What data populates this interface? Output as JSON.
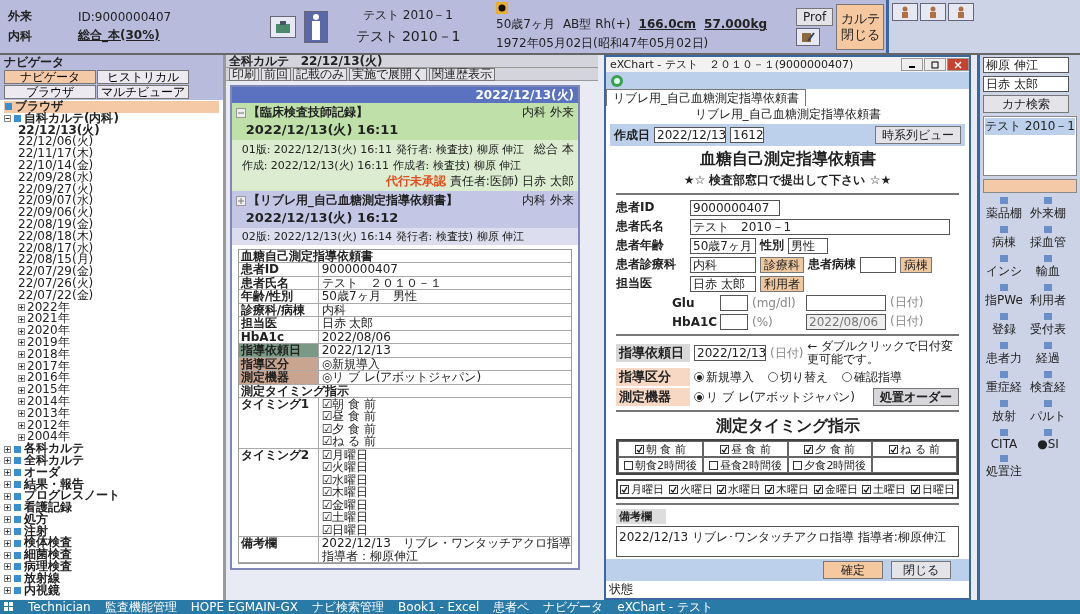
{
  "header": {
    "visit_type": "外来",
    "department": "内科",
    "patient_id": "ID:9000000407",
    "insurance": "総合_本(30%)",
    "patient_name_small": "テスト 2010－1",
    "patient_name": "テスト 2010－1",
    "age": "50歳7ヶ月",
    "blood_type": "AB型 Rh(+)",
    "height": "166.0cm",
    "weight": "57.000kg",
    "birthdate": "1972年05月02日(昭和47年05月02日)",
    "prof_button": "Prof",
    "close_button": "カルテ閉じる"
  },
  "navigator": {
    "title": "ナビゲータ",
    "tabs": [
      {
        "label": "ナビゲータ",
        "selected": true
      },
      {
        "label": "ヒストリカル",
        "selected": false
      },
      {
        "label": "ブラウザ",
        "selected": false
      },
      {
        "label": "マルチビューア",
        "selected": false
      }
    ],
    "tree": [
      {
        "label": "ブラウザ",
        "selected": true
      },
      {
        "label": "自科カルテ(内科)",
        "selected": false,
        "expanded": true,
        "children": [
          {
            "label": "22/12/13(火)",
            "selected": true
          },
          {
            "label": "22/12/06(火)",
            "selected": false
          },
          {
            "label": "22/11/17(木)",
            "selected": false
          },
          {
            "label": "22/10/14(金)",
            "selected": false
          },
          {
            "label": "22/09/28(水)",
            "selected": false
          },
          {
            "label": "22/09/27(火)",
            "selected": false
          },
          {
            "label": "22/09/07(水)",
            "selected": false
          },
          {
            "label": "22/09/06(火)",
            "selected": false
          },
          {
            "label": "22/08/19(金)",
            "selected": false
          },
          {
            "label": "22/08/18(木)",
            "selected": false
          },
          {
            "label": "22/08/17(水)",
            "selected": false
          },
          {
            "label": "22/08/15(月)",
            "selected": false
          },
          {
            "label": "22/07/29(金)",
            "selected": false
          },
          {
            "label": "22/07/26(火)",
            "selected": false
          },
          {
            "label": "22/07/22(金)",
            "selected": false
          },
          {
            "label": "2022年",
            "selected": false,
            "expanded": false
          },
          {
            "label": "2021年",
            "selected": false,
            "expanded": false
          },
          {
            "label": "2020年",
            "selected": false,
            "expanded": false
          },
          {
            "label": "2019年",
            "selected": false,
            "expanded": false
          },
          {
            "label": "2018年",
            "selected": false,
            "expanded": false
          },
          {
            "label": "2017年",
            "selected": false,
            "expanded": false
          },
          {
            "label": "2016年",
            "selected": false,
            "expanded": false
          },
          {
            "label": "2015年",
            "selected": false,
            "expanded": false
          },
          {
            "label": "2014年",
            "selected": false,
            "expanded": false
          },
          {
            "label": "2013年",
            "selected": false,
            "expanded": false
          },
          {
            "label": "2012年",
            "selected": false,
            "expanded": false
          },
          {
            "label": "2004年",
            "selected": false,
            "expanded": false
          }
        ]
      },
      {
        "label": "各科カルテ",
        "selected": false,
        "expanded": false
      },
      {
        "label": "全科カルテ",
        "selected": false,
        "expanded": false
      },
      {
        "label": "オーダ",
        "selected": false,
        "expanded": false
      },
      {
        "label": "結果・報告",
        "selected": false,
        "expanded": false
      },
      {
        "label": "プログレスノート",
        "selected": false,
        "expanded": false
      },
      {
        "label": "看護記録",
        "selected": false,
        "expanded": false
      },
      {
        "label": "処方",
        "selected": false,
        "expanded": false
      },
      {
        "label": "注射",
        "selected": false,
        "expanded": false
      },
      {
        "label": "検体検査",
        "selected": false,
        "expanded": false
      },
      {
        "label": "細菌検査",
        "selected": false,
        "expanded": false
      },
      {
        "label": "病理検査",
        "selected": false,
        "expanded": false
      },
      {
        "label": "放射線",
        "selected": false,
        "expanded": false
      },
      {
        "label": "内視鏡",
        "selected": false,
        "expanded": false
      }
    ]
  },
  "chart_view": {
    "title": "全科カルテ　22/12/13(火)",
    "toolbar": [
      "印刷",
      "前回",
      "記載のみ",
      "実施で展開く",
      "関連歴表示"
    ],
    "date": "2022/12/13(火)",
    "records": [
      {
        "kind": "technician",
        "expanded": true,
        "title": "【臨床検査技師記録】",
        "department": "内科 外来",
        "datetime": "2022/12/13(火) 16:11",
        "lines": [
          "01版: 2022/12/13(火) 16:11 発行者: 検査技) 柳原 伸江",
          "作成: 2022/12/13(火) 16:11 作成者: 検査技) 柳原 伸江"
        ],
        "insurance": "総合 本",
        "approval": "代行未承認",
        "responsible": "責任者:医師) 日赤 太郎"
      },
      {
        "kind": "document",
        "expanded": false,
        "title": "【リブレ用_自己血糖測定指導依頼書】",
        "department": "内科 外来",
        "datetime": "2022/12/13(火) 16:12",
        "lines": [
          "02版: 2022/12/13(火) 16:14 発行者: 検査技) 柳原 伸江"
        ]
      }
    ],
    "summary": [
      {
        "kind": "title",
        "label": "血糖自己測定指導依頼書"
      },
      {
        "kind": "row",
        "label": "患者ID",
        "values": [
          "9000000407"
        ]
      },
      {
        "kind": "row",
        "label": "患者氏名",
        "values": [
          "テスト　２０１０－１"
        ]
      },
      {
        "kind": "row",
        "label": "年齢/性別",
        "values": [
          "50歳7ヶ月　男性"
        ]
      },
      {
        "kind": "row",
        "label": "診療科/病棟",
        "values": [
          "内科"
        ]
      },
      {
        "kind": "row",
        "label": "担当医",
        "values": [
          "日赤 太郎"
        ]
      },
      {
        "kind": "row",
        "label": "HbA1c",
        "values": [
          "2022/08/06"
        ]
      },
      {
        "kind": "row",
        "label": "指導依頼日",
        "values": [
          "2022/12/13"
        ],
        "color": "#7a9a86"
      },
      {
        "kind": "row",
        "label": "指導区分",
        "values": [
          "◎新規導入"
        ],
        "color": "#c9a48e"
      },
      {
        "kind": "row",
        "label": "測定機器",
        "values": [
          "◎リ ブ レ(アボットジャパン)"
        ],
        "color": "#c9a48e"
      },
      {
        "kind": "title",
        "label": "測定タイミング指示"
      },
      {
        "kind": "row",
        "label": "タイミング1",
        "values": [
          "☑朝 食 前",
          "☑昼 食 前",
          "☑夕 食 前",
          "☑ね る 前"
        ]
      },
      {
        "kind": "row",
        "label": "タイミング2",
        "values": [
          "☑月曜日",
          "☑火曜日",
          "☑水曜日",
          "☑木曜日",
          "☑金曜日",
          "☑土曜日",
          "☑日曜日"
        ]
      },
      {
        "kind": "row",
        "label": "備考欄",
        "values": [
          "2022/12/13　リブレ・ワンタッチアクロ指導",
          "指導者：柳原伸江"
        ]
      }
    ]
  },
  "form_window": {
    "title": "eXChart - テスト　２０１０－１(9000000407)",
    "tab": "リブレ用_自己血糖測定指導依頼書",
    "subtitle": "リブレ用_自己血糖測定指導依頼書",
    "created_label": "作成日",
    "created_date": "2022/12/13",
    "created_time": "1612",
    "timeline_button": "時系列ビュー",
    "heading": "血糖自己測定指導依頼書",
    "note": "★☆ 検査部窓口で提出して下さい ☆★",
    "fields": [
      {
        "label": "患者ID",
        "value": "9000000407",
        "kind": "short"
      },
      {
        "label": "患者氏名",
        "value": "テスト　2010－1",
        "kind": "long"
      }
    ],
    "age_label": "患者年齢",
    "age": "50歳7ヶ月",
    "sex_label": "性別",
    "sex": "男性",
    "dept_label": "患者診療科",
    "dept": "内科",
    "dept_button": "診療科",
    "ward_label": "患者病棟",
    "ward_button": "病棟",
    "doctor_label": "担当医",
    "doctor": "日赤 太郎",
    "doctor_button": "利用者",
    "labs": [
      {
        "label": "Glu",
        "unit": "(mg/dl)",
        "date_label": "(日付)"
      },
      {
        "label": "HbA1C",
        "unit": "(%)",
        "date": "2022/08/06",
        "date_label": "(日付)"
      }
    ],
    "request_date_label": "指導依頼日",
    "request_date": "2022/12/13",
    "request_date_hint": "(日付)",
    "request_date_note": "← ダブルクリックで日付変更可能です。",
    "guidance_label": "指導区分",
    "guidance_options": [
      {
        "label": "新規導入",
        "selected": true
      },
      {
        "label": "切り替え",
        "selected": false
      },
      {
        "label": "確認指導",
        "selected": false
      }
    ],
    "device_label": "測定機器",
    "device_options": [
      {
        "label": "リ ブ レ(アボットジャパン)",
        "selected": true
      }
    ],
    "order_button": "処置オーダー",
    "timing_title": "測定タイミング指示",
    "timing": [
      {
        "label": "朝 食 前",
        "checked": true
      },
      {
        "label": "昼 食 前",
        "checked": true
      },
      {
        "label": "夕 食 前",
        "checked": true
      },
      {
        "label": "ね る 前",
        "checked": true
      },
      {
        "label": "朝食2時間後",
        "checked": false
      },
      {
        "label": "昼食2時間後",
        "checked": false
      },
      {
        "label": "夕食2時間後",
        "checked": false
      }
    ],
    "days": [
      {
        "label": "月曜日",
        "checked": true
      },
      {
        "label": "火曜日",
        "checked": true
      },
      {
        "label": "水曜日",
        "checked": true
      },
      {
        "label": "木曜日",
        "checked": true
      },
      {
        "label": "金曜日",
        "checked": true
      },
      {
        "label": "土曜日",
        "checked": true
      },
      {
        "label": "日曜日",
        "checked": true
      }
    ],
    "remarks_label": "備考欄",
    "remarks": "2022/12/13 リブレ･ワンタッチアクロ指導 指導者:柳原伸江",
    "confirm_button": "確定",
    "close_button": "閉じる",
    "status": "状態"
  },
  "side_panel": {
    "user": "柳原 伸江",
    "doctor": "日赤 太郎",
    "search_button": "カナ検索",
    "patients": [
      "テスト 2010－1"
    ],
    "tools": [
      "薬品棚",
      "外来棚",
      "病棟",
      "採血管",
      "インシ",
      "輸血",
      "指PWe",
      "利用者",
      "登録",
      "受付表",
      "患者力",
      "経過",
      "重症経",
      "検査経",
      "放射",
      "パルト",
      "CITA",
      "●SI",
      "処置注"
    ]
  },
  "taskbar": [
    "Technician",
    "監査機能管理",
    "HOPE EGMAIN-GX",
    "ナビ検索管理",
    "Book1 - Excel",
    "患者ペ",
    "ナビゲータ",
    "eXChart - テスト"
  ]
}
